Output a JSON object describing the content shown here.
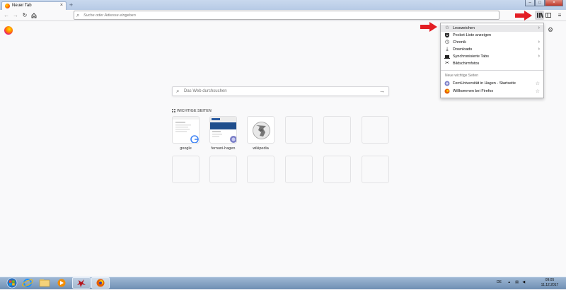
{
  "tab": {
    "title": "Neuer Tab"
  },
  "urlbar": {
    "placeholder": "Suche oder Adresse eingeben"
  },
  "search": {
    "placeholder": "Das Web durchsuchen"
  },
  "topsites": {
    "heading": "WICHTIGE SEITEN",
    "sites": [
      {
        "label": "google"
      },
      {
        "label": "fernuni-hagen"
      },
      {
        "label": "wikipedia"
      }
    ]
  },
  "library_menu": {
    "items": [
      {
        "label": "Lesezeichen",
        "icon": "star-icon"
      },
      {
        "label": "Pocket-Liste anzeigen",
        "icon": "pocket-icon"
      },
      {
        "label": "Chronik",
        "icon": "clock-icon"
      },
      {
        "label": "Downloads",
        "icon": "download-icon"
      },
      {
        "label": "Synchronisierte Tabs",
        "icon": "sync-tabs-icon"
      },
      {
        "label": "Bildschirmfotos",
        "icon": "screenshot-icon"
      }
    ],
    "section_header": "Neue wichtige Seiten",
    "recent": [
      {
        "label": "FernUniversität in Hagen - Startseite"
      },
      {
        "label": "Willkommen bei Firefox"
      }
    ]
  },
  "taskbar": {
    "tray_lang": "DE",
    "time": "09:05",
    "date": "11.12.2017"
  },
  "colors": {
    "arrow": "#e31e24",
    "accent": "#0a84ff"
  }
}
